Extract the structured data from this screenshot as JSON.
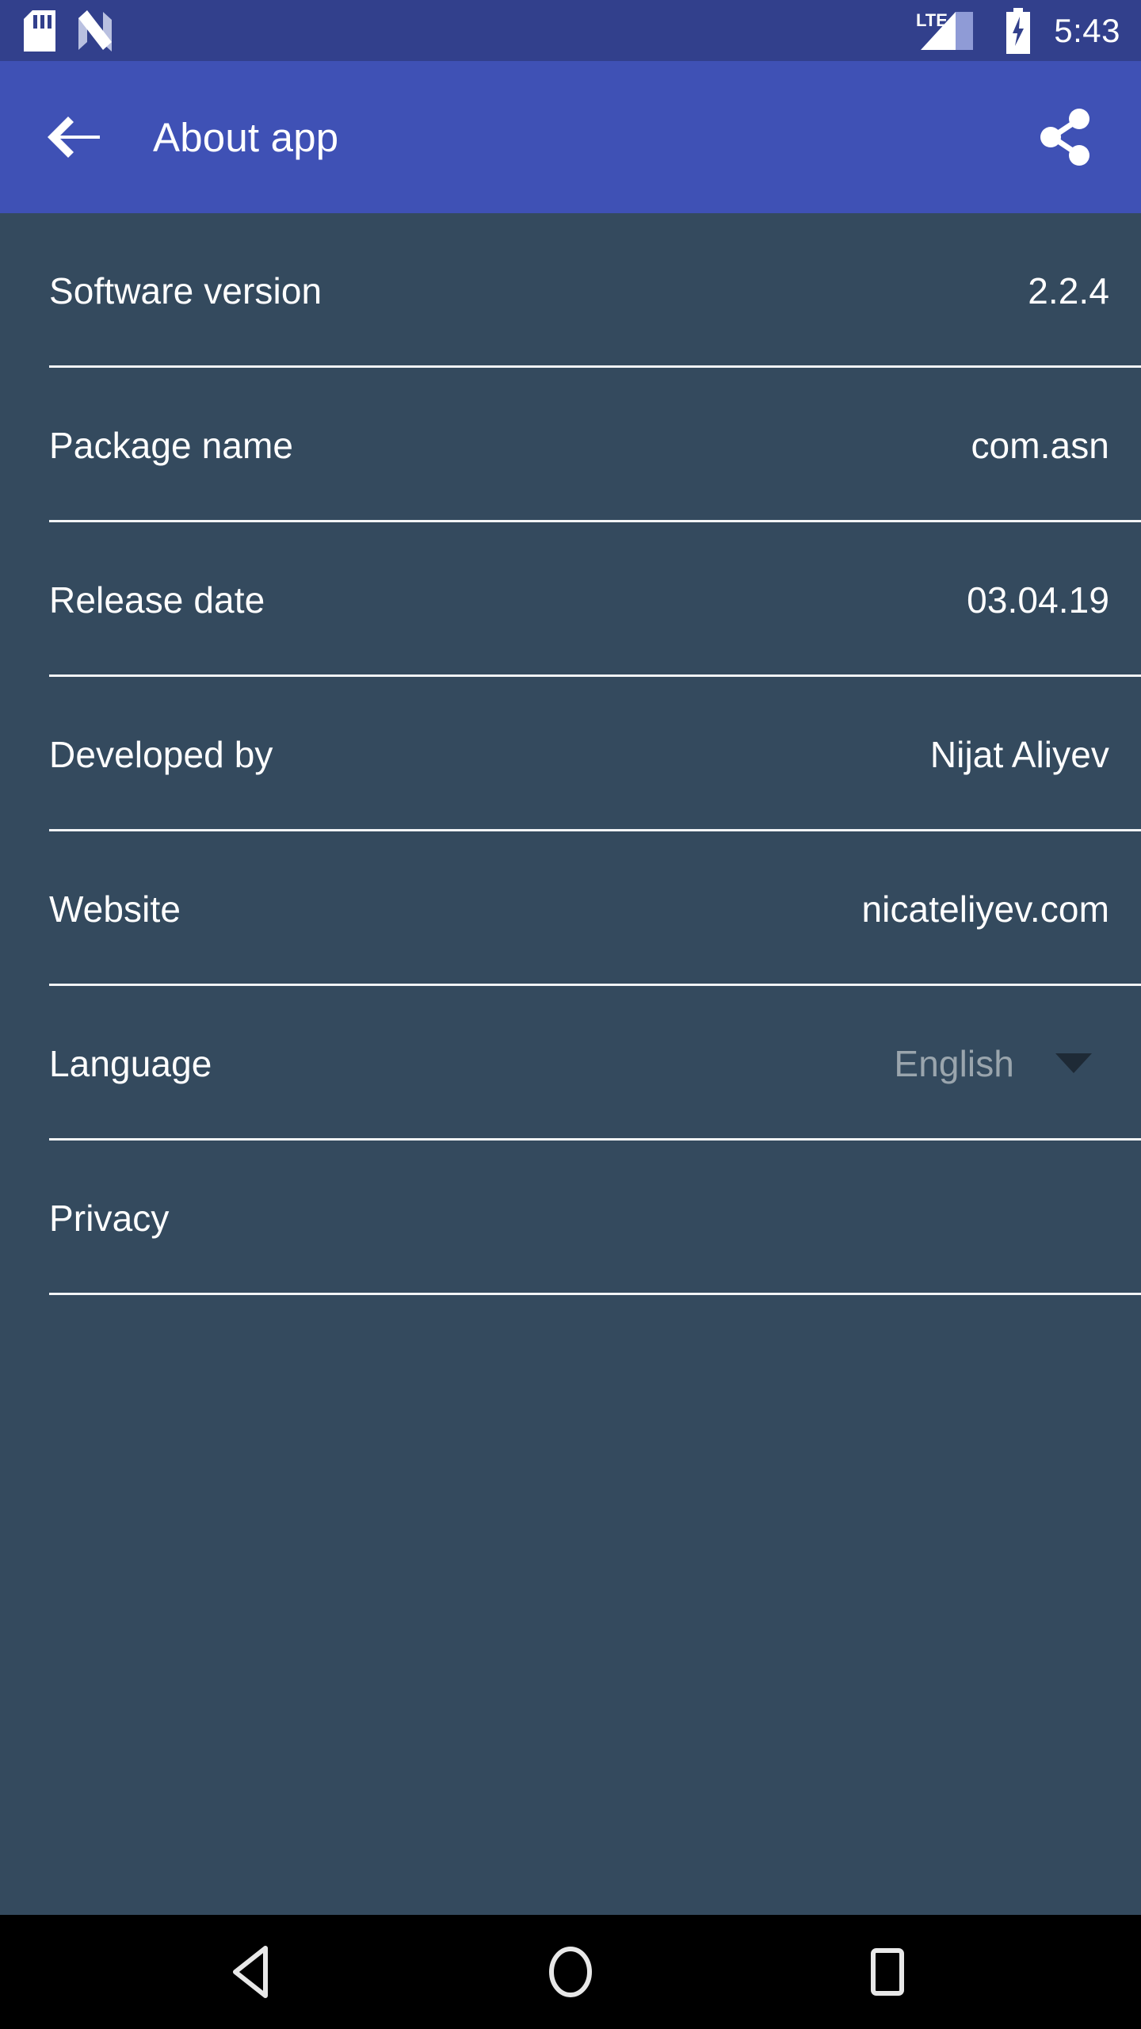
{
  "status_bar": {
    "icons": [
      "sd-card-icon",
      "android-nougat-icon"
    ],
    "network_label": "LTE",
    "signal_icon": "signal-bars-icon",
    "battery_icon": "battery-charging-icon",
    "time": "5:43",
    "background_color": "#32408C"
  },
  "app_bar": {
    "back_icon": "arrow-back-icon",
    "title": "About app",
    "share_icon": "share-icon",
    "background_color": "#3F51B5",
    "text_color": "#FFFFFF"
  },
  "content": {
    "background_color": "#344A5E",
    "divider_color": "#F2F4F6",
    "rows": [
      {
        "label": "Software version",
        "value": "2.2.4",
        "type": "info"
      },
      {
        "label": "Package name",
        "value": "com.asn",
        "type": "info"
      },
      {
        "label": "Release date",
        "value": "03.04.19",
        "type": "info"
      },
      {
        "label": "Developed by",
        "value": "Nijat Aliyev",
        "type": "info"
      },
      {
        "label": "Website",
        "value": "nicateliyev.com",
        "type": "info"
      },
      {
        "label": "Language",
        "value": "English",
        "type": "spinner",
        "value_color": "#9AA5AD"
      },
      {
        "label": "Privacy",
        "value": "",
        "type": "action"
      }
    ]
  },
  "nav_bar": {
    "background_color": "#000000",
    "buttons": [
      {
        "name": "back-nav-button",
        "icon": "triangle-back-icon"
      },
      {
        "name": "home-nav-button",
        "icon": "circle-home-icon"
      },
      {
        "name": "recents-nav-button",
        "icon": "square-recents-icon"
      }
    ]
  }
}
